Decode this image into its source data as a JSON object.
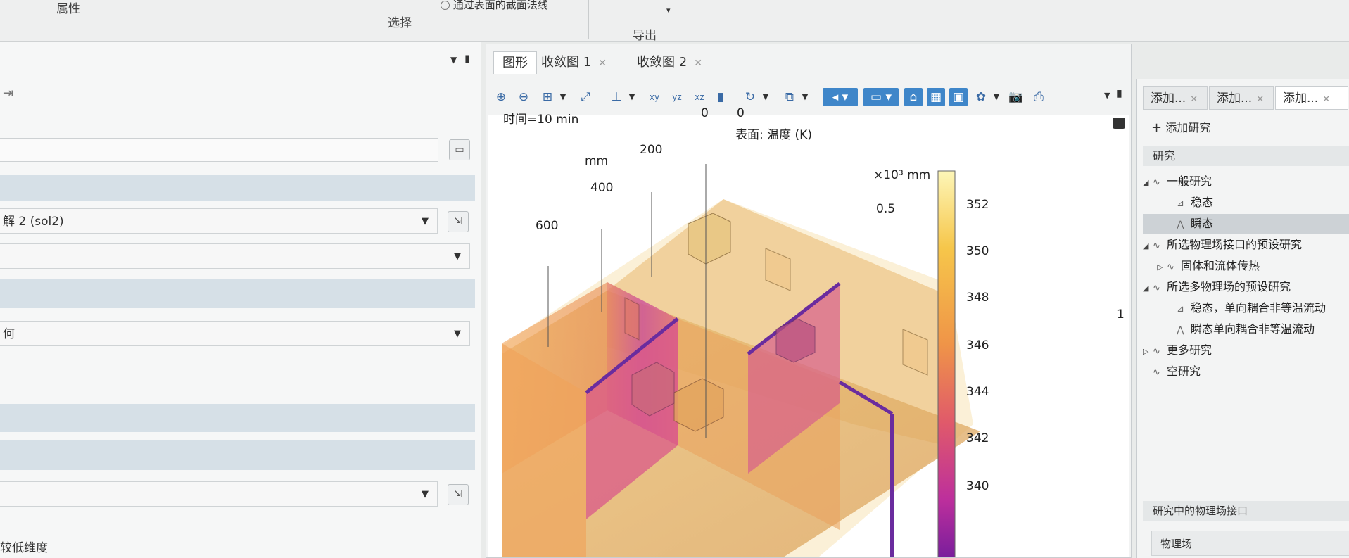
{
  "ribbon": {
    "group_properties": "属性",
    "group_selection": "选择",
    "group_export": "导出",
    "normal_line_item": "通过表面的截面法线"
  },
  "left_panel": {
    "solution_combo": "解 2 (sol2)",
    "geometry_combo": "何",
    "reduced_dim_label": "较低维度"
  },
  "graphics": {
    "tabs": [
      {
        "label": "图形"
      },
      {
        "label": "收敛图 1"
      },
      {
        "label": "收敛图 2"
      }
    ],
    "time_label": "时间=10 min",
    "surface_label": "表面: 温度 (K)",
    "axis_mm_label": "mm",
    "axis_x103_label": "×10³ mm",
    "axis_ticks": [
      "0",
      "0",
      "200",
      "400",
      "600",
      "0.5",
      "1"
    ],
    "colorbar": {
      "ticks": [
        "352",
        "350",
        "348",
        "346",
        "344",
        "342",
        "340"
      ],
      "colors": [
        "#fdf6b8",
        "#f6c64a",
        "#ef9448",
        "#e05a6a",
        "#bd2f9c",
        "#7a1e9c"
      ]
    }
  },
  "right_panel": {
    "tabs": [
      {
        "label": "添加..."
      },
      {
        "label": "添加..."
      },
      {
        "label": "添加..."
      }
    ],
    "add_study_button": "添加研究",
    "studies_header": "研究",
    "tree": [
      {
        "label": "一般研究",
        "level": 0,
        "icon": "study-group-icon"
      },
      {
        "label": "稳态",
        "level": 1,
        "icon": "stationary-icon"
      },
      {
        "label": "瞬态",
        "level": 1,
        "icon": "transient-icon",
        "selected": true
      },
      {
        "label": "所选物理场接口的预设研究",
        "level": 0,
        "icon": "study-group-icon"
      },
      {
        "label": "固体和流体传热",
        "level": 1,
        "icon": "study-group-icon"
      },
      {
        "label": "所选多物理场的预设研究",
        "level": 0,
        "icon": "study-group-icon"
      },
      {
        "label": "稳态，单向耦合非等温流动",
        "level": 1,
        "icon": "stationary-icon"
      },
      {
        "label": "瞬态单向耦合非等温流动",
        "level": 1,
        "icon": "transient-icon"
      },
      {
        "label": "更多研究",
        "level": 0,
        "icon": "study-group-icon"
      },
      {
        "label": "空研究",
        "level": 0,
        "icon": "study-group-icon"
      }
    ],
    "physics_header": "研究中的物理场接口",
    "physics_column": "物理场"
  }
}
